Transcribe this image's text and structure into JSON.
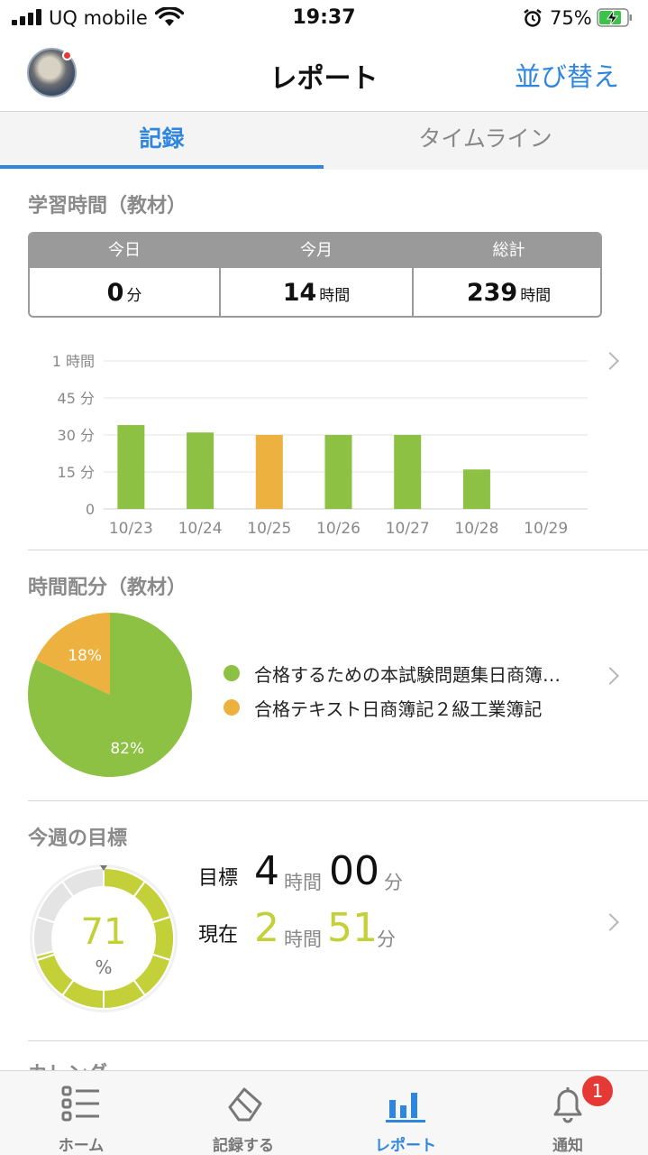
{
  "status_bar": {
    "carrier": "UQ mobile",
    "time": "19:37",
    "battery": "75%"
  },
  "nav": {
    "title": "レポート",
    "sort_label": "並び替え"
  },
  "tabs": [
    {
      "label": "記録",
      "active": true
    },
    {
      "label": "タイムライン",
      "active": false
    }
  ],
  "study_time": {
    "title": "学習時間（教材）",
    "summary": [
      {
        "header": "今日",
        "value": "0",
        "unit": "分"
      },
      {
        "header": "今月",
        "value": "14",
        "unit": "時間"
      },
      {
        "header": "総計",
        "value": "239",
        "unit": "時間"
      }
    ]
  },
  "chart_data": {
    "type": "bar",
    "categories": [
      "10/23",
      "10/24",
      "10/25",
      "10/26",
      "10/27",
      "10/28",
      "10/29"
    ],
    "values": [
      34,
      31,
      30,
      30,
      30,
      16,
      0
    ],
    "bar_colors": [
      "#8dc143",
      "#8dc143",
      "#ecb13e",
      "#8dc143",
      "#8dc143",
      "#8dc143",
      "#8dc143"
    ],
    "y_ticks": [
      {
        "value": 0,
        "label": "0"
      },
      {
        "value": 15,
        "label": "15 分"
      },
      {
        "value": 30,
        "label": "30 分"
      },
      {
        "value": 45,
        "label": "45 分"
      },
      {
        "value": 60,
        "label": "1 時間"
      }
    ],
    "ylim": [
      0,
      60
    ],
    "title": "",
    "xlabel": "",
    "ylabel": "",
    "grid": true
  },
  "distribution": {
    "title": "時間配分（教材）",
    "slices": [
      {
        "label": "合格するための本試験問題集日商簿…",
        "percent": 82,
        "percent_label": "82%",
        "color": "#8dc143"
      },
      {
        "label": "合格テキスト日商簿記２級工業簿記",
        "percent": 18,
        "percent_label": "18%",
        "color": "#ecb13e"
      }
    ]
  },
  "weekly_goal": {
    "title": "今週の目標",
    "progress_percent": 71,
    "progress_label": "71",
    "percent_sign": "%",
    "target_label": "目標",
    "target_hours": "4",
    "target_minutes": "00",
    "current_label": "現在",
    "current_hours": "2",
    "current_minutes": "51",
    "hour_unit": "時間",
    "minute_unit": "分",
    "accent_color": "#c3d037"
  },
  "next_section_title": "カレンダー",
  "bottom_nav": [
    {
      "label": "ホーム",
      "icon": "list-icon",
      "active": false
    },
    {
      "label": "記録する",
      "icon": "eraser-icon",
      "active": false
    },
    {
      "label": "レポート",
      "icon": "bar-chart-icon",
      "active": true
    },
    {
      "label": "通知",
      "icon": "bell-icon",
      "active": false,
      "badge": "1"
    }
  ]
}
